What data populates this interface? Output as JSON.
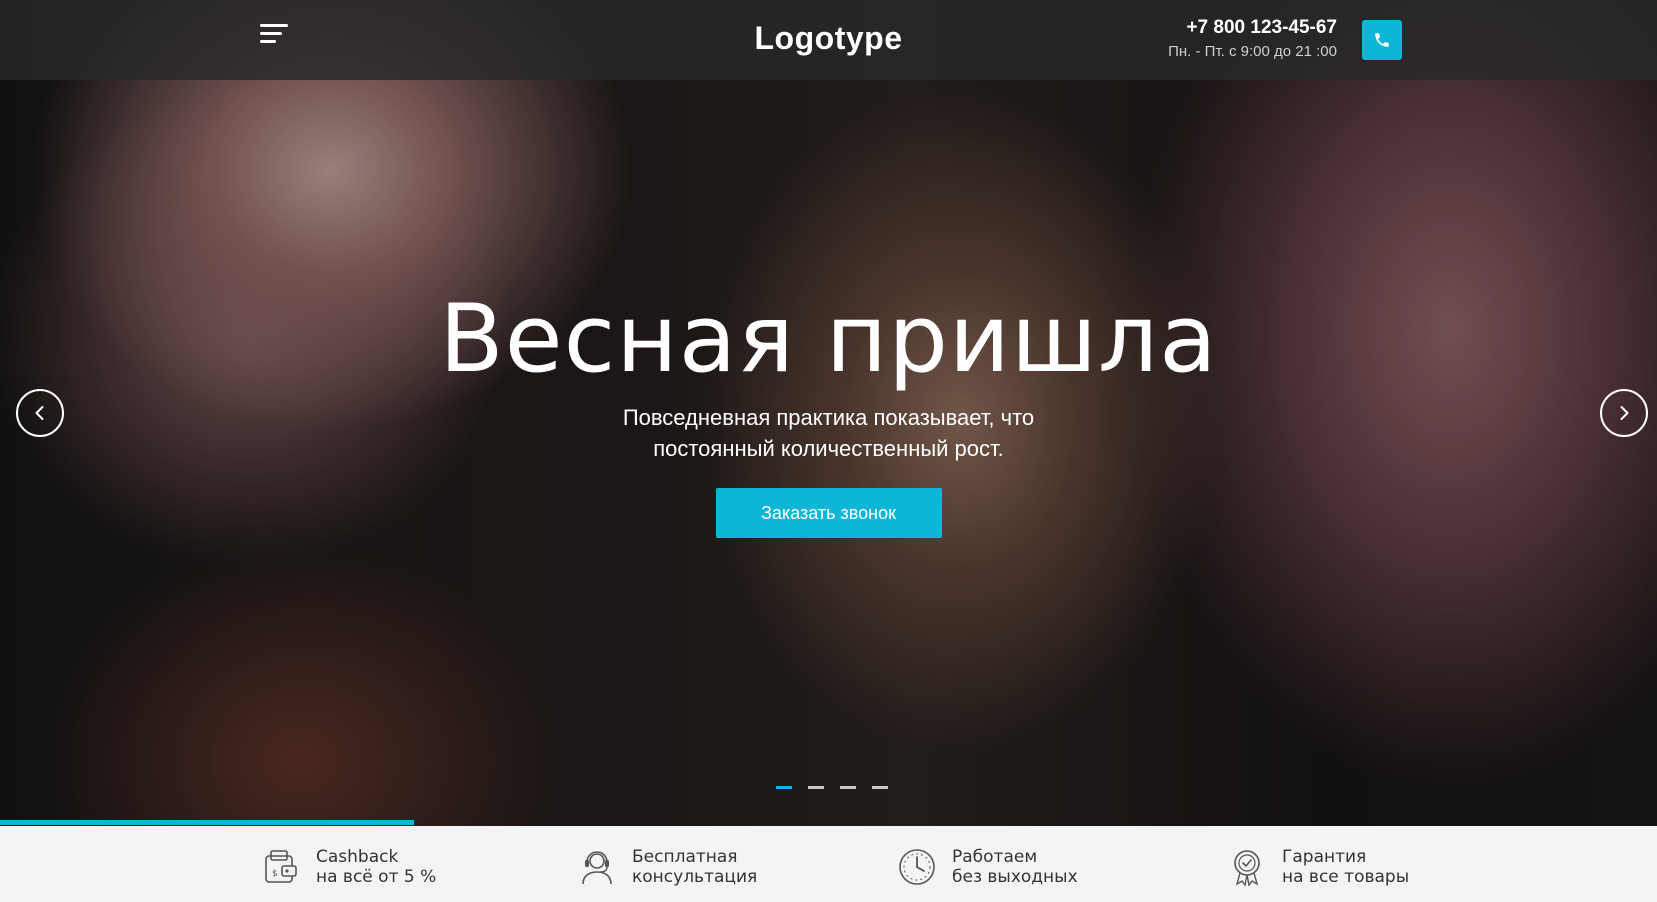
{
  "header": {
    "logo": "Logotype",
    "phone": "+7 800 123-45-67",
    "hours": "Пн. - Пт. с 9:00 до 21 :00",
    "menu_icon": "hamburger-menu-icon",
    "call_icon": "phone-icon"
  },
  "hero": {
    "title": "Весная пришла",
    "subtitle": "Повседневная практика показывает, что постоянный количественный рост.",
    "cta_label": "Заказать звонок",
    "prev_icon": "chevron-left-icon",
    "next_icon": "chevron-right-icon",
    "slides_total": 4,
    "active_slide": 1,
    "progress_fraction": 0.25
  },
  "features": [
    {
      "icon": "wallet-cashback-icon",
      "line1": "Cashback",
      "line2": "на всё от 5 %"
    },
    {
      "icon": "headset-operator-icon",
      "line1": "Бесплатная",
      "line2": "консультация"
    },
    {
      "icon": "clock-icon",
      "line1": "Работаем",
      "line2": "без выходных"
    },
    {
      "icon": "award-badge-icon",
      "line1": "Гарантия",
      "line2": "на все товары"
    }
  ],
  "colors": {
    "accent": "#0db5d6",
    "header_bg": "#282828",
    "features_bg": "#f4f4f4",
    "text_dark": "#333333"
  }
}
